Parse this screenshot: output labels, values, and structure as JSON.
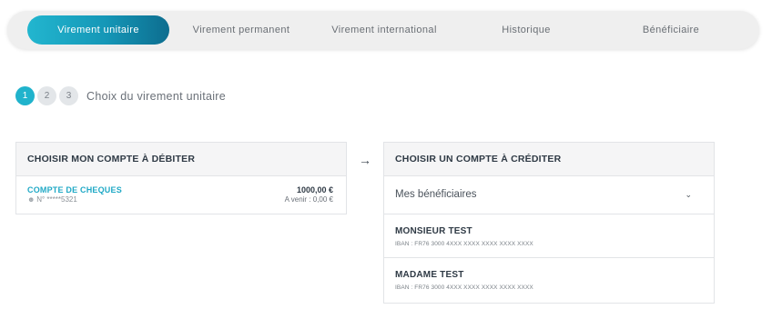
{
  "tabs": [
    {
      "label": "Virement unitaire",
      "active": true
    },
    {
      "label": "Virement permanent",
      "active": false
    },
    {
      "label": "Virement international",
      "active": false
    },
    {
      "label": "Historique",
      "active": false
    },
    {
      "label": "Bénéficiaire",
      "active": false
    }
  ],
  "stepper": {
    "steps": [
      "1",
      "2",
      "3"
    ],
    "current": 1,
    "title": "Choix du virement unitaire"
  },
  "debit": {
    "header": "CHOISIR MON COMPTE À DÉBITER",
    "account": {
      "name": "COMPTE DE CHEQUES",
      "number": "N° *****5321",
      "balance": "1000,00 €",
      "a_venir": "A venir : 0,00 €"
    }
  },
  "arrow": "→",
  "credit": {
    "header": "CHOISIR UN COMPTE À CRÉDITER",
    "select": {
      "label": "Mes bénéficiaires",
      "chevron": "⌄"
    },
    "beneficiaries": [
      {
        "name": "MONSIEUR TEST",
        "iban": "IBAN : FR76 3000 4XXX XXXX XXXX XXXX XXXX"
      },
      {
        "name": "MADAME TEST",
        "iban": "IBAN : FR76 3000 4XXX XXXX XXXX XXXX XXXX"
      }
    ]
  },
  "colors": {
    "accent": "#20b3cc",
    "accent_dark": "#0d6d8f"
  },
  "icons": {
    "account_owner": "user-icon",
    "arrow": "arrow-right-icon",
    "select": "chevron-down-icon"
  }
}
